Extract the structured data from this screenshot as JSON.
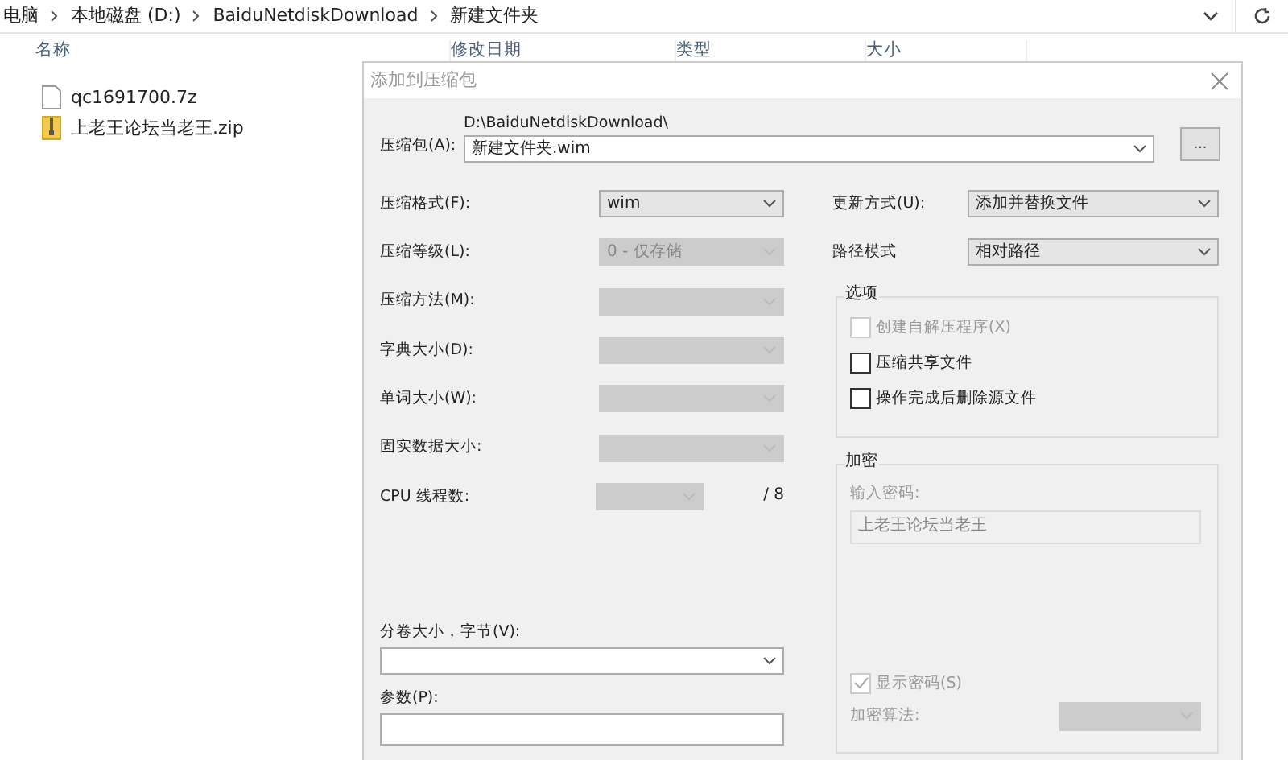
{
  "explorer": {
    "breadcrumb": [
      "电脑",
      "本地磁盘 (D:)",
      "BaiduNetdiskDownload",
      "新建文件夹"
    ],
    "columns": [
      "名称",
      "修改日期",
      "类型",
      "大小"
    ],
    "files": [
      {
        "name": "qc1691700.7z",
        "kind": "file"
      },
      {
        "name": "上老王论坛当老王.zip",
        "kind": "zip"
      }
    ]
  },
  "dialog": {
    "title": "添加到压缩包",
    "archive": {
      "label": "压缩包(A):",
      "path": "D:\\BaiduNetdiskDownload\\",
      "value": "新建文件夹.wim",
      "browse": "..."
    },
    "left_rows": [
      {
        "label": "压缩格式(F):",
        "value": "wim",
        "disabled": false,
        "kind": "select"
      },
      {
        "label": "压缩等级(L):",
        "value": "0 - 仅存储",
        "disabled": true,
        "kind": "select"
      },
      {
        "label": "压缩方法(M):",
        "disabled": true,
        "kind": "select"
      },
      {
        "label": "字典大小(D):",
        "disabled": true,
        "kind": "select"
      },
      {
        "label": "单词大小(W):",
        "disabled": true,
        "kind": "select"
      },
      {
        "label": "固实数据大小:",
        "disabled": true,
        "kind": "select"
      },
      {
        "label": "CPU 线程数:",
        "disabled": true,
        "kind": "threads",
        "suffix": "/ 8"
      }
    ],
    "volume": {
      "label": "分卷大小，字节(V):"
    },
    "params": {
      "label": "参数(P):"
    },
    "right_rows": [
      {
        "label": "更新方式(U):",
        "value": "添加并替换文件"
      },
      {
        "label": "路径模式",
        "value": "相对路径"
      }
    ],
    "options": {
      "title": "选项",
      "items": [
        {
          "label": "创建自解压程序(X)",
          "checked": false,
          "disabled": true
        },
        {
          "label": "压缩共享文件",
          "checked": false,
          "disabled": false
        },
        {
          "label": "操作完成后删除源文件",
          "checked": false,
          "disabled": false
        }
      ]
    },
    "encryption": {
      "title": "加密",
      "password_label": "输入密码:",
      "password": "上老王论坛当老王",
      "show_password": {
        "label": "显示密码(S)",
        "checked": true,
        "disabled": true
      },
      "method_label": "加密算法:"
    }
  }
}
